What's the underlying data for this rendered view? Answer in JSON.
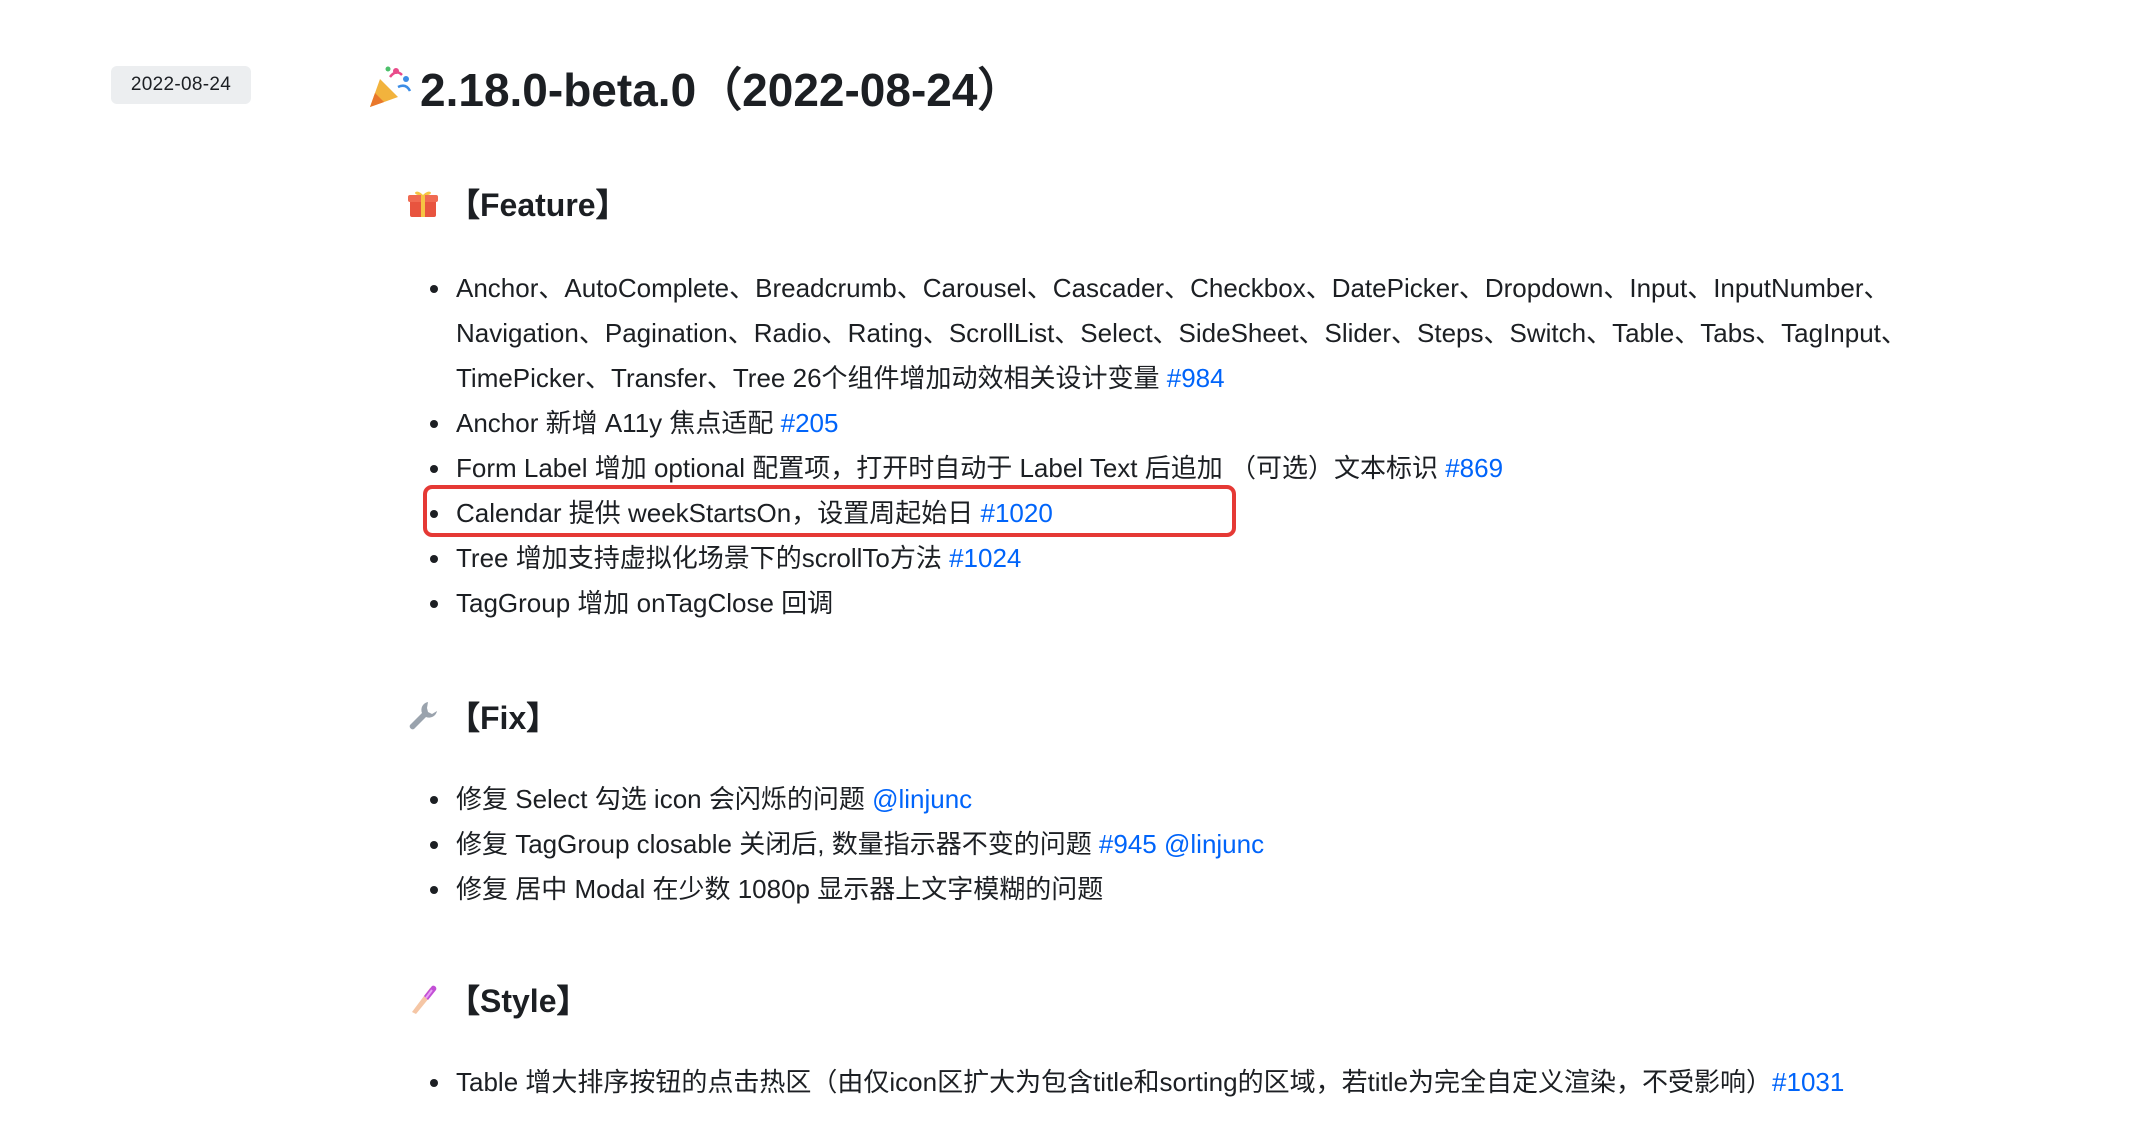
{
  "date_badge": "2022-08-24",
  "release": {
    "title": "2.18.0-beta.0（2022-08-24）",
    "icon": "party-popper-icon"
  },
  "sections": {
    "feature": {
      "heading": "【Feature】",
      "icon": "gift-icon",
      "items": {
        "i0": {
          "line1": "Anchor、AutoComplete、Breadcrumb、Carousel、Cascader、Checkbox、DatePicker、Dropdown、Input、InputNumber、",
          "line2": "Navigation、Pagination、Radio、Rating、ScrollList、Select、SideSheet、Slider、Steps、Switch、Table、Tabs、TagInput、",
          "line3": "TimePicker、Transfer、Tree 26个组件增加动效相关设计变量 ",
          "link": "#984"
        },
        "i1": {
          "text": "Anchor 新增 A11y 焦点适配 ",
          "link": "#205"
        },
        "i2": {
          "text": "Form Label 增加 optional 配置项，打开时自动于 Label Text 后追加 （可选）文本标识 ",
          "link": "#869"
        },
        "i3": {
          "text": "Calendar 提供 weekStartsOn，设置周起始日 ",
          "link": "#1020"
        },
        "i4": {
          "text": "Tree 增加支持虚拟化场景下的scrollTo方法 ",
          "link": "#1024"
        },
        "i5": {
          "text": "TagGroup 增加 onTagClose 回调"
        }
      }
    },
    "fix": {
      "heading": "【Fix】",
      "icon": "wrench-icon",
      "items": {
        "i0": {
          "text": "修复 Select 勾选 icon 会闪烁的问题 ",
          "link": "@linjunc"
        },
        "i1": {
          "text": "修复 TagGroup closable 关闭后, 数量指示器不变的问题 ",
          "link": "#945",
          "link2": "@linjunc"
        },
        "i2": {
          "text": "修复 居中 Modal 在少数 1080p 显示器上文字模糊的问题"
        }
      }
    },
    "style": {
      "heading": "【Style】",
      "icon": "nail-polish-icon",
      "items": {
        "i0": {
          "text": "Table 增大排序按钮的点击热区（由仅icon区扩大为包含title和sorting的区域，若title为完全自定义渲染，不受影响）",
          "link": "#1031"
        }
      }
    }
  },
  "colors": {
    "link": "#0064fa",
    "highlight": "#e53935",
    "text": "#1c1f23",
    "badge_bg": "#eceef0"
  }
}
